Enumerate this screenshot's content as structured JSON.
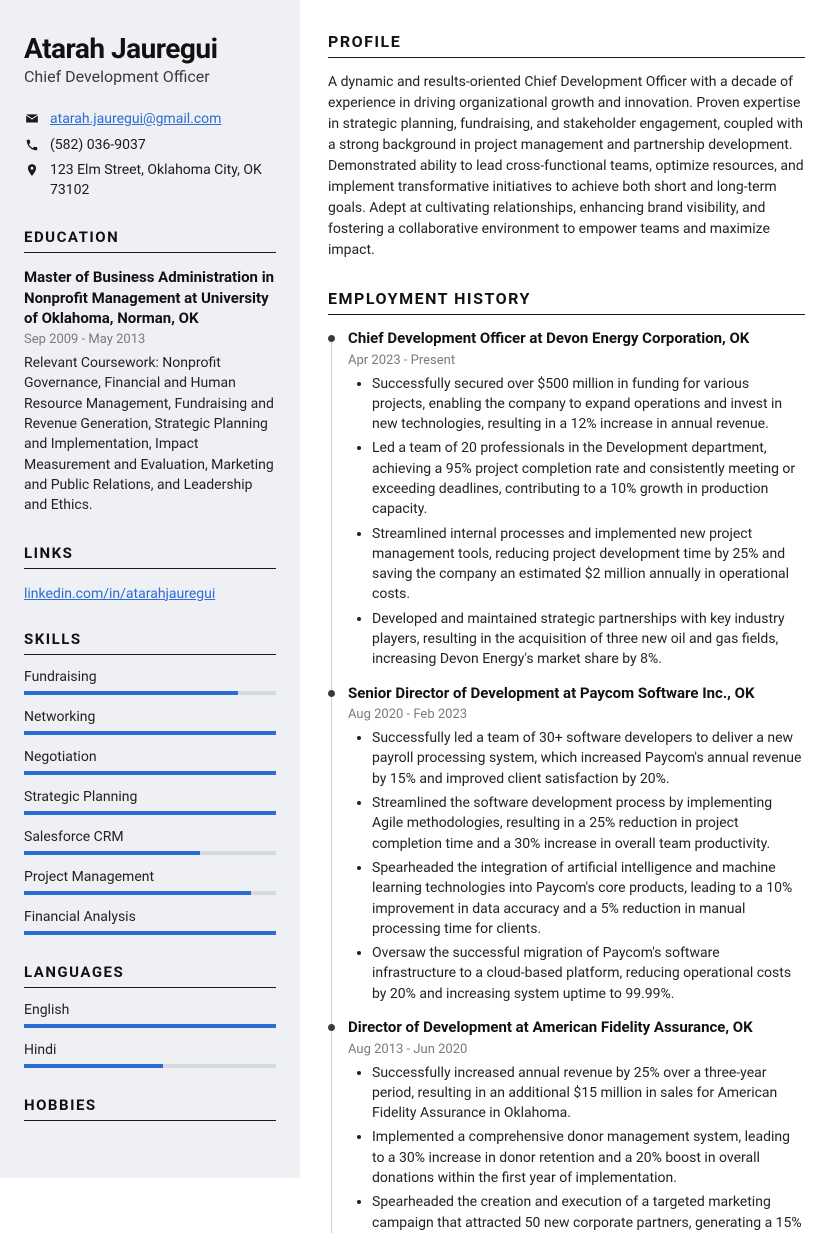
{
  "name": "Atarah Jauregui",
  "title": "Chief Development Officer",
  "contact": {
    "email": "atarah.jauregui@gmail.com",
    "phone": "(582) 036-9037",
    "address": "123 Elm Street, Oklahoma City, OK 73102"
  },
  "sections": {
    "education": "EDUCATION",
    "links": "LINKS",
    "skills": "SKILLS",
    "languages": "LANGUAGES",
    "hobbies": "HOBBIES",
    "profile": "PROFILE",
    "employment": "EMPLOYMENT HISTORY"
  },
  "education": {
    "degree": "Master of Business Administration in Nonprofit Management at University of Oklahoma, Norman, OK",
    "dates": "Sep 2009 - May 2013",
    "coursework": "Relevant Coursework: Nonprofit Governance, Financial and Human Resource Management, Fundraising and Revenue Generation, Strategic Planning and Implementation, Impact Measurement and Evaluation, Marketing and Public Relations, and Leadership and Ethics."
  },
  "links": {
    "linkedin": "linkedin.com/in/atarahjauregui"
  },
  "skills": [
    {
      "name": "Fundraising",
      "level": 85
    },
    {
      "name": "Networking",
      "level": 100
    },
    {
      "name": "Negotiation",
      "level": 100
    },
    {
      "name": "Strategic Planning",
      "level": 100
    },
    {
      "name": "Salesforce CRM",
      "level": 70
    },
    {
      "name": "Project Management",
      "level": 90
    },
    {
      "name": "Financial Analysis",
      "level": 100
    }
  ],
  "languages": [
    {
      "name": "English",
      "level": 100
    },
    {
      "name": "Hindi",
      "level": 55
    }
  ],
  "profile": "A dynamic and results-oriented Chief Development Officer with a decade of experience in driving organizational growth and innovation. Proven expertise in strategic planning, fundraising, and stakeholder engagement, coupled with a strong background in project management and partnership development. Demonstrated ability to lead cross-functional teams, optimize resources, and implement transformative initiatives to achieve both short and long-term goals. Adept at cultivating relationships, enhancing brand visibility, and fostering a collaborative environment to empower teams and maximize impact.",
  "jobs": [
    {
      "title": "Chief Development Officer at Devon Energy Corporation, OK",
      "dates": "Apr 2023 - Present",
      "bullets": [
        "Successfully secured over $500 million in funding for various projects, enabling the company to expand operations and invest in new technologies, resulting in a 12% increase in annual revenue.",
        "Led a team of 20 professionals in the Development department, achieving a 95% project completion rate and consistently meeting or exceeding deadlines, contributing to a 10% growth in production capacity.",
        "Streamlined internal processes and implemented new project management tools, reducing project development time by 25% and saving the company an estimated $2 million annually in operational costs.",
        "Developed and maintained strategic partnerships with key industry players, resulting in the acquisition of three new oil and gas fields, increasing Devon Energy's market share by 8%."
      ]
    },
    {
      "title": "Senior Director of Development at Paycom Software Inc., OK",
      "dates": "Aug 2020 - Feb 2023",
      "bullets": [
        "Successfully led a team of 30+ software developers to deliver a new payroll processing system, which increased Paycom's annual revenue by 15% and improved client satisfaction by 20%.",
        "Streamlined the software development process by implementing Agile methodologies, resulting in a 25% reduction in project completion time and a 30% increase in overall team productivity.",
        "Spearheaded the integration of artificial intelligence and machine learning technologies into Paycom's core products, leading to a 10% improvement in data accuracy and a 5% reduction in manual processing time for clients.",
        "Oversaw the successful migration of Paycom's software infrastructure to a cloud-based platform, reducing operational costs by 20% and increasing system uptime to 99.99%."
      ]
    },
    {
      "title": "Director of Development at American Fidelity Assurance, OK",
      "dates": "Aug 2013 - Jun 2020",
      "bullets": [
        "Successfully increased annual revenue by 25% over a three-year period, resulting in an additional $15 million in sales for American Fidelity Assurance in Oklahoma.",
        "Implemented a comprehensive donor management system, leading to a 30% increase in donor retention and a 20% boost in overall donations within the first year of implementation.",
        "Spearheaded the creation and execution of a targeted marketing campaign that attracted 50 new corporate partners, generating a 15%"
      ]
    }
  ]
}
